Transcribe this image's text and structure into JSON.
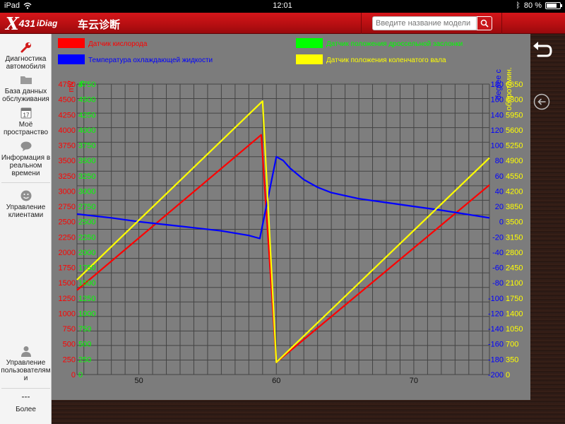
{
  "statusbar": {
    "device": "iPad",
    "time": "12:01",
    "battery": "80 %",
    "battery_level": 0.8
  },
  "app": {
    "logo_x": "X",
    "logo_num": "431",
    "logo_rest": "iDiag",
    "title": "车云诊断"
  },
  "search": {
    "placeholder": "Введите название модели"
  },
  "sidebar": {
    "items": [
      {
        "label": "Диагностика автомобиля",
        "icon": "wrench-icon"
      },
      {
        "label": "База данных обслуживания",
        "icon": "folder-icon"
      },
      {
        "label": "Моё пространство",
        "icon": "calendar-icon",
        "calendar_day": "17"
      },
      {
        "label": "Информация в реальном времени",
        "icon": "chat-bubble-icon"
      },
      {
        "label": "Управление клиентами",
        "icon": "smiley-icon"
      },
      {
        "label": "Управление пользователям и",
        "icon": "user-icon"
      },
      {
        "label": "Более",
        "icon": "more-icon",
        "glyph": "---"
      }
    ]
  },
  "chart_data": {
    "type": "line",
    "legend": [
      {
        "name": "Датчик кислорода",
        "color": "#ff0000"
      },
      {
        "name": "Датчик положения дроссельной заслонки",
        "color": "#00ff00"
      },
      {
        "name": "Температура охлаждающей жидкости",
        "color": "#0000ff"
      },
      {
        "name": "Датчик положения коленчатого вала",
        "color": "#ffff00"
      }
    ],
    "xlim": [
      45.5,
      75.5
    ],
    "x_ticks": [
      50,
      60,
      70
    ],
    "axes": {
      "red": {
        "label": "mV",
        "color": "#ff0000",
        "min": 0,
        "max": 4750,
        "step": 250
      },
      "green": {
        "label": "%",
        "color": "#00ff00",
        "min": 0,
        "max": 4750,
        "step": 250
      },
      "blue": {
        "label": "degree c",
        "color": "#0000ff",
        "min": -200,
        "max": 180,
        "step": 20
      },
      "yellow": {
        "label": "оборот/мин.",
        "color": "#ffff00",
        "min": 0,
        "max": 6650,
        "step": 350
      }
    },
    "series": [
      {
        "name": "Датчик кислорода",
        "axis": "red",
        "color": "#ff0000",
        "x": [
          45.5,
          58.9,
          60,
          75.5
        ],
        "y": [
          1380,
          3920,
          200,
          3100
        ]
      },
      {
        "name": "Температура охлаждающей жидкости",
        "axis": "blue",
        "color": "#0000ff",
        "x": [
          45.5,
          48,
          50,
          52,
          54,
          56,
          58,
          58.8,
          60,
          60.5,
          61,
          62,
          63,
          64,
          66,
          68,
          70,
          72,
          75.5
        ],
        "y": [
          10,
          5,
          0,
          -4,
          -8,
          -12,
          -18,
          -22,
          85,
          80,
          70,
          55,
          45,
          38,
          30,
          25,
          20,
          15,
          5
        ]
      },
      {
        "name": "Датчик положения коленчатого вала",
        "axis": "yellow",
        "color": "#ffff00",
        "x": [
          45.5,
          59,
          60,
          75.5
        ],
        "y": [
          2170,
          6260,
          280,
          4960
        ]
      }
    ]
  }
}
